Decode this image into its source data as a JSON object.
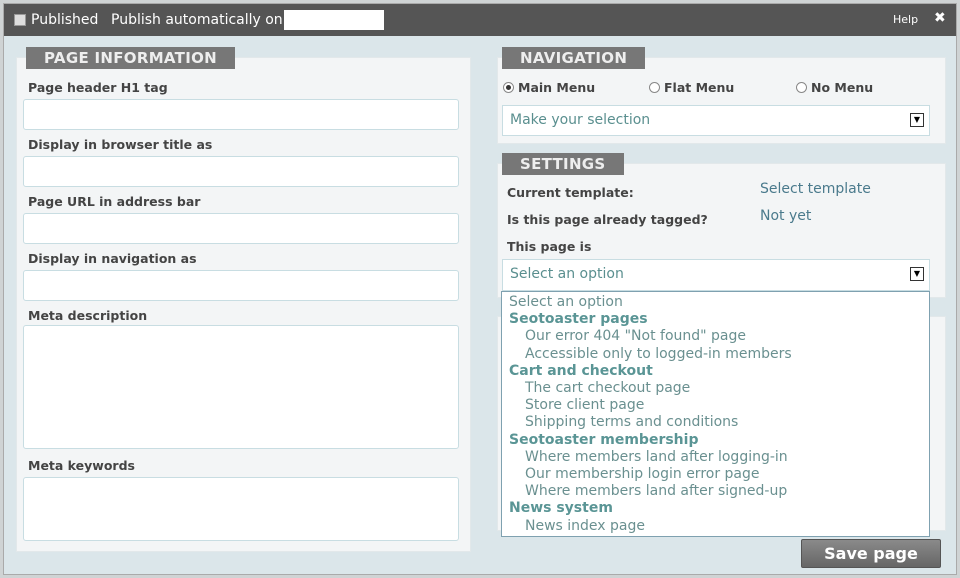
{
  "topbar": {
    "published_label": "Published",
    "published_checked": false,
    "auto_label": "Publish automatically on:",
    "auto_value": "",
    "help": "Help",
    "close_icon": "close-icon"
  },
  "page_info": {
    "title": "PAGE INFORMATION",
    "fields": [
      {
        "label": "Page header H1 tag",
        "value": ""
      },
      {
        "label": "Display in browser title as",
        "value": ""
      },
      {
        "label": "Page URL in address bar",
        "value": ""
      },
      {
        "label": "Display in navigation as",
        "value": ""
      },
      {
        "label": "Meta description",
        "value": ""
      },
      {
        "label": "Meta keywords",
        "value": ""
      }
    ]
  },
  "navigation": {
    "title": "NAVIGATION",
    "options": [
      {
        "label": "Main Menu",
        "selected": true
      },
      {
        "label": "Flat Menu",
        "selected": false
      },
      {
        "label": "No Menu",
        "selected": false
      }
    ],
    "select_value": "Make your selection"
  },
  "settings": {
    "title": "SETTINGS",
    "template_label": "Current template:",
    "template_value": "Select template",
    "tagged_label": "Is this page already tagged?",
    "tagged_value": "Not yet",
    "page_is_label": "This page is",
    "select_value": "Select an option"
  },
  "dropdown": {
    "items": [
      {
        "t": "Select an option",
        "k": "p"
      },
      {
        "t": "Seotoaster pages",
        "k": "g"
      },
      {
        "t": "Our error 404 \"Not found\" page",
        "k": "o"
      },
      {
        "t": "Accessible only to logged-in members",
        "k": "o"
      },
      {
        "t": "Cart and checkout",
        "k": "g"
      },
      {
        "t": "The cart checkout page",
        "k": "o"
      },
      {
        "t": "Store client page",
        "k": "o"
      },
      {
        "t": "Shipping terms and conditions",
        "k": "o"
      },
      {
        "t": "Seotoaster membership",
        "k": "g"
      },
      {
        "t": "Where members land after logging-in",
        "k": "o"
      },
      {
        "t": "Our membership login error page",
        "k": "o"
      },
      {
        "t": "Where members land after signed-up",
        "k": "o"
      },
      {
        "t": "News system",
        "k": "g"
      },
      {
        "t": "News index page",
        "k": "o"
      }
    ]
  },
  "save_label": "Save page"
}
